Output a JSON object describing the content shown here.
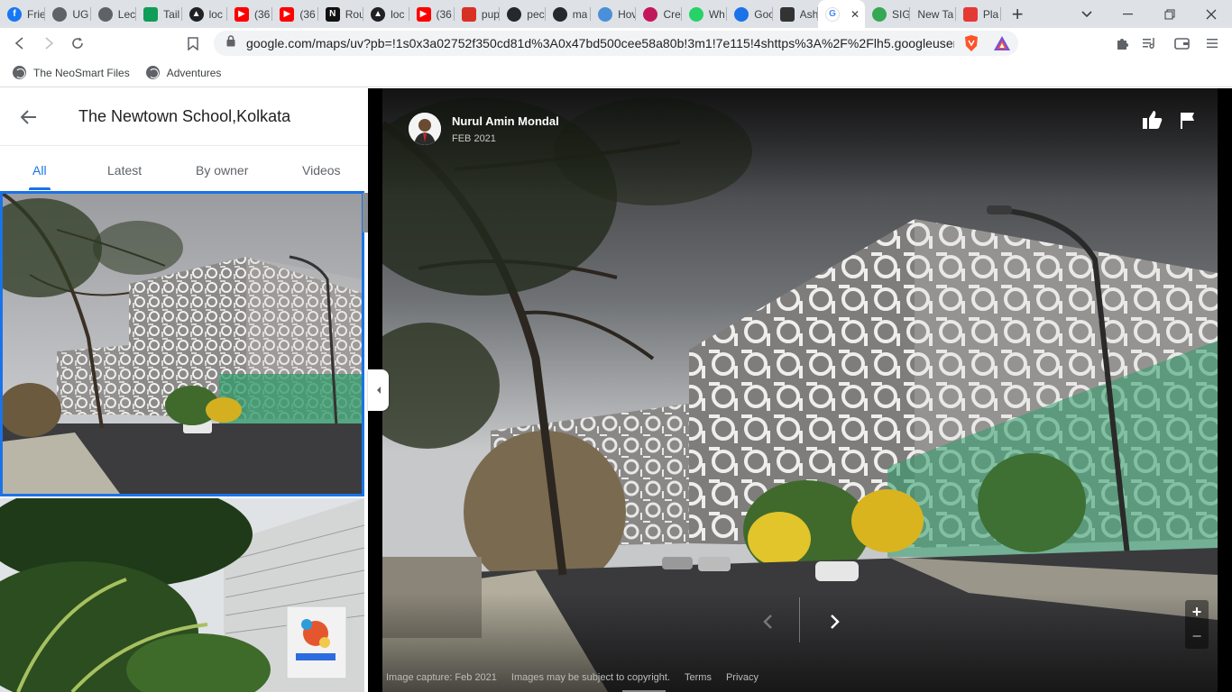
{
  "browser": {
    "tabs": [
      {
        "title": "Frie",
        "icon": "facebook-icon",
        "color": "#1877f2"
      },
      {
        "title": "UG",
        "icon": "globe-icon",
        "color": "#5f6368"
      },
      {
        "title": "Lec",
        "icon": "globe-icon",
        "color": "#5f6368"
      },
      {
        "title": "Tail",
        "icon": "sheet-icon",
        "color": "#0f9d58"
      },
      {
        "title": "loc",
        "icon": "render-icon",
        "color": "#202124"
      },
      {
        "title": "(36",
        "icon": "youtube-icon",
        "color": "#ff0000"
      },
      {
        "title": "(36",
        "icon": "youtube-icon",
        "color": "#ff0000"
      },
      {
        "title": "Rou",
        "icon": "notion-icon",
        "color": "#111111"
      },
      {
        "title": "loc",
        "icon": "render-icon",
        "color": "#202124"
      },
      {
        "title": "(36",
        "icon": "youtube-icon",
        "color": "#ff0000"
      },
      {
        "title": "pup",
        "icon": "pup-icon",
        "color": "#d93025"
      },
      {
        "title": "pec",
        "icon": "github-icon",
        "color": "#24292f"
      },
      {
        "title": "ma",
        "icon": "github-icon",
        "color": "#24292f"
      },
      {
        "title": "Hov",
        "icon": "link-icon",
        "color": "#4a90d9"
      },
      {
        "title": "Cre",
        "icon": "pin-icon",
        "color": "#c2185b"
      },
      {
        "title": "Wh",
        "icon": "whatsapp-icon",
        "color": "#25d366"
      },
      {
        "title": "Goo",
        "icon": "meet-icon",
        "color": "#1a73e8"
      },
      {
        "title": "Ash",
        "icon": "trello-icon",
        "color": "#333333"
      },
      {
        "title": "",
        "icon": "google-icon",
        "color": "#4285f4",
        "active": true
      },
      {
        "title": "SIG",
        "icon": "maps-icon",
        "color": "#34a853"
      },
      {
        "title": "New Ta",
        "icon": "none",
        "color": "#dee1e6"
      },
      {
        "title": "Pla",
        "icon": "app-icon",
        "color": "#e53935"
      }
    ],
    "new_tab_label": "+",
    "url": "google.com/maps/uv?pb=!1s0x3a02752f350cd81d%3A0x47bd500cee58a80b!3m1!7e115!4shttps%3A%2F%2Flh5.googleuser...",
    "bookmarks": [
      {
        "label": "The NeoSmart Files"
      },
      {
        "label": "Adventures"
      }
    ]
  },
  "panel": {
    "title": "The Newtown School,Kolkata",
    "tabs": [
      {
        "label": "All",
        "active": true
      },
      {
        "label": "Latest"
      },
      {
        "label": "By owner"
      },
      {
        "label": "Videos"
      }
    ]
  },
  "photo": {
    "author": "Nurul Amin Mondal",
    "date": "FEB 2021",
    "footer": {
      "capture": "Image capture: Feb 2021",
      "copyright": "Images may be subject to copyright.",
      "terms": "Terms",
      "privacy": "Privacy"
    },
    "zoom_in": "+",
    "zoom_out": "−"
  },
  "colors": {
    "accent": "#1a73e8",
    "chrome_bg": "#dee1e6"
  }
}
